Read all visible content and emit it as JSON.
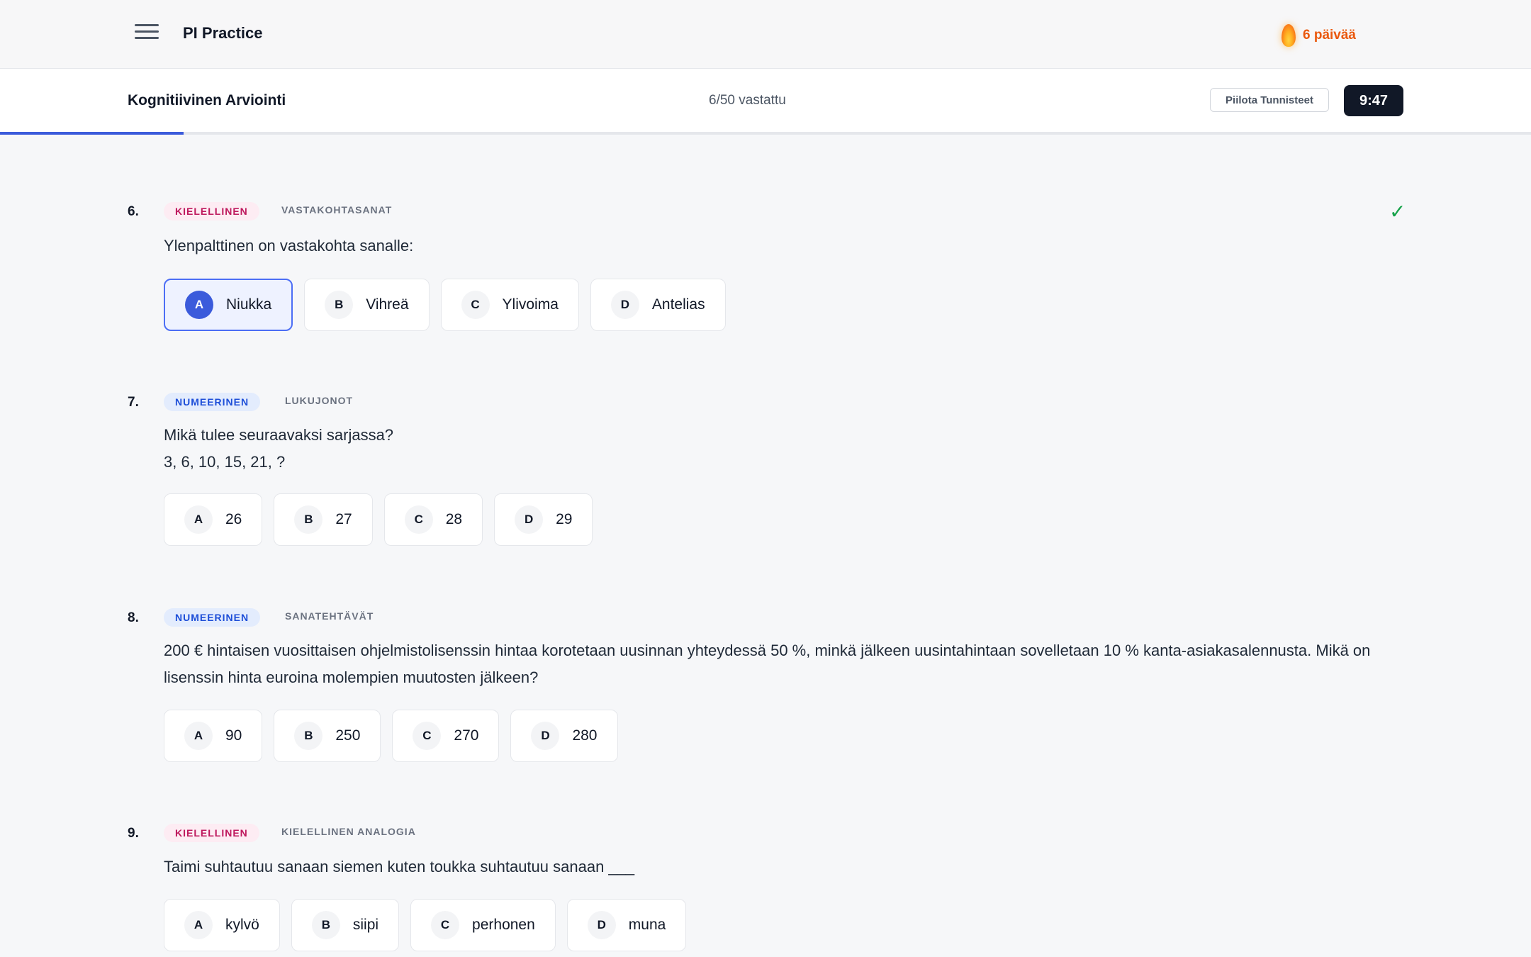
{
  "app": {
    "name": "PI Practice",
    "streak": "6 päivää"
  },
  "header": {
    "title": "Kognitiivinen Arviointi",
    "progress": "6/50 vastattu",
    "progress_fraction": 0.12,
    "hide_label": "Piilota Tunnisteet",
    "timer": "9:47"
  },
  "icons": {
    "menu": "hamburger-icon",
    "streak": "flame-icon",
    "answered": "check-icon"
  },
  "colors": {
    "accent": "#3b5bdb",
    "verbal": "#be185d",
    "numeric": "#1d4ed8",
    "streak": "#ea580c",
    "answered": "#16a34a"
  },
  "questions": [
    {
      "number": "6.",
      "category": "KIELELLINEN",
      "subcategory": "VASTAKOHTASANAT",
      "answered_mark": "✓",
      "lines": [
        "Ylenpalttinen on vastakohta sanalle:"
      ],
      "selected": "A",
      "options": [
        {
          "letter": "A",
          "text": "Niukka"
        },
        {
          "letter": "B",
          "text": "Vihreä"
        },
        {
          "letter": "C",
          "text": "Ylivoima"
        },
        {
          "letter": "D",
          "text": "Antelias"
        }
      ]
    },
    {
      "number": "7.",
      "category": "NUMEERINEN",
      "subcategory": "LUKUJONOT",
      "lines": [
        "Mikä tulee seuraavaksi sarjassa?",
        "3, 6, 10, 15, 21, ?"
      ],
      "options": [
        {
          "letter": "A",
          "text": "26"
        },
        {
          "letter": "B",
          "text": "27"
        },
        {
          "letter": "C",
          "text": "28"
        },
        {
          "letter": "D",
          "text": "29"
        }
      ]
    },
    {
      "number": "8.",
      "category": "NUMEERINEN",
      "subcategory": "SANATEHTÄVÄT",
      "lines": [
        "200 € hintaisen vuosittaisen ohjelmistolisenssin hintaa korotetaan uusinnan yhteydessä 50 %, minkä jälkeen uusintahintaan sovelletaan 10 % kanta-asiakasalennusta. Mikä on lisenssin hinta euroina molempien muutosten jälkeen?"
      ],
      "options": [
        {
          "letter": "A",
          "text": "90"
        },
        {
          "letter": "B",
          "text": "250"
        },
        {
          "letter": "C",
          "text": "270"
        },
        {
          "letter": "D",
          "text": "280"
        }
      ]
    },
    {
      "number": "9.",
      "category": "KIELELLINEN",
      "subcategory": "KIELELLINEN ANALOGIA",
      "lines": [
        "Taimi suhtautuu sanaan siemen kuten toukka suhtautuu sanaan ___"
      ],
      "options": [
        {
          "letter": "A",
          "text": "kylvö"
        },
        {
          "letter": "B",
          "text": "siipi"
        },
        {
          "letter": "C",
          "text": "perhonen"
        },
        {
          "letter": "D",
          "text": "muna"
        }
      ]
    }
  ]
}
